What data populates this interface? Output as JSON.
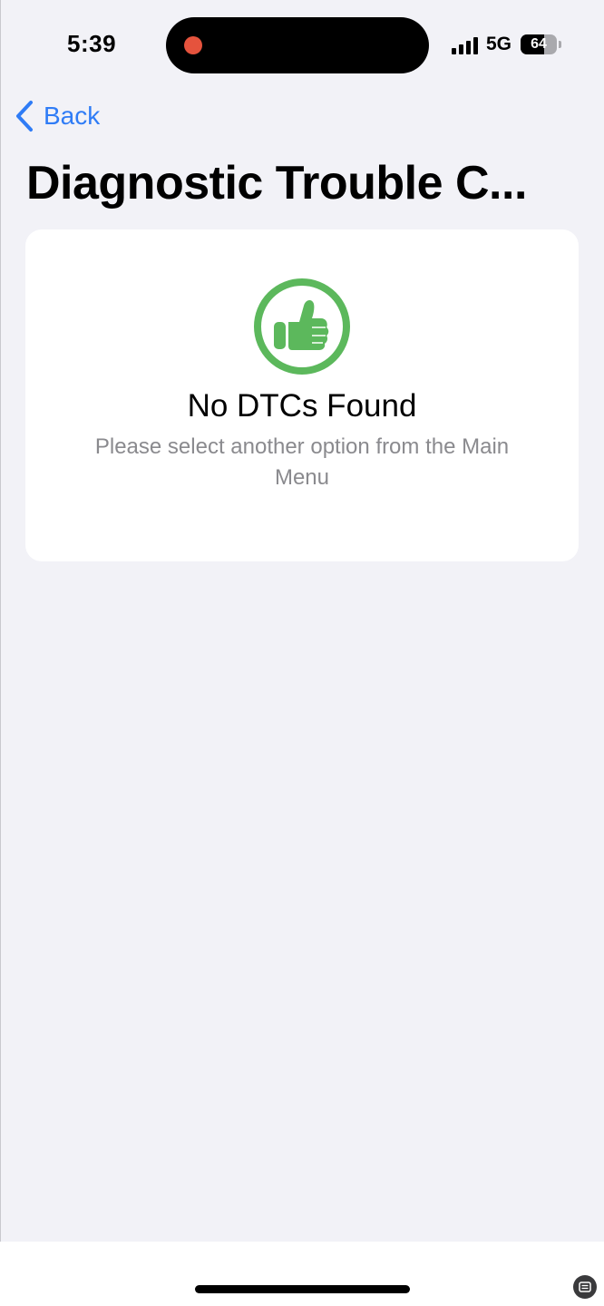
{
  "status_bar": {
    "time": "5:39",
    "network": "5G",
    "battery_level": "64",
    "battery_fraction": 0.64,
    "recording_color": "#e5533d"
  },
  "nav": {
    "back_label": "Back",
    "accent_color": "#2f7cf6"
  },
  "page": {
    "title": "Diagnostic Trouble C..."
  },
  "card": {
    "icon": "thumbs-up-icon",
    "icon_color": "#5cb85c",
    "title": "No DTCs Found",
    "subtitle": "Please select another option from the Main Menu"
  }
}
